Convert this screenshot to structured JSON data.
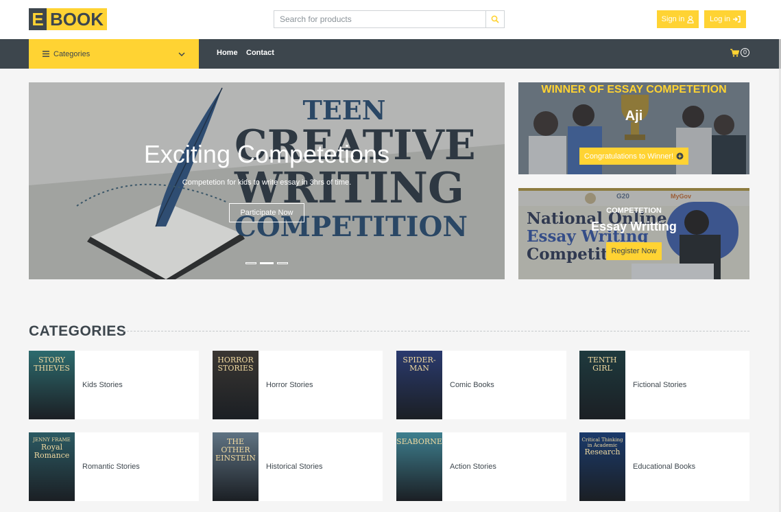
{
  "brand": {
    "e": "E",
    "book": "BOOK"
  },
  "search": {
    "placeholder": "Search for products"
  },
  "auth": {
    "sign_in": "Sign in",
    "log_in": "Log in"
  },
  "nav": {
    "categories": "Categories",
    "links": [
      "Home",
      "Contact"
    ],
    "cart_count": "0"
  },
  "hero": {
    "title": "Exciting Competetions",
    "subtitle": "Competetion for kids to write essay in 3hrs of time.",
    "button": "Participate Now",
    "image_text": [
      "TEEN",
      "CREATIVE",
      "WRITING",
      "COMPETITION"
    ],
    "active_slide": 2,
    "slides": 3
  },
  "promo1": {
    "heading": "WINNER OF ESSAY COMPETETION",
    "name": "Aji",
    "button": "Congratulations to Winner!"
  },
  "promo2": {
    "kicker": "COMPETETION",
    "title": "Essay Writting",
    "button": "Register Now",
    "bg_text": [
      "National Online",
      "Essay Writing",
      "Competition"
    ],
    "logos": [
      "G20",
      "MyGov"
    ]
  },
  "categories": {
    "heading": "CATEGORIES",
    "items": [
      {
        "label": "Kids Stories",
        "cover_text": [
          "STORY",
          "THIEVES"
        ],
        "cover_color": "#2d6b6e"
      },
      {
        "label": "Horror Stories",
        "cover_text": [
          "HORROR",
          "STORIES"
        ],
        "cover_color": "#3a3632"
      },
      {
        "label": "Comic Books",
        "cover_text": [
          "SPIDER-MAN"
        ],
        "cover_color": "#2a3a6e"
      },
      {
        "label": "Fictional Stories",
        "cover_text": [
          "TENTH",
          "GIRL"
        ],
        "cover_color": "#1e3a3e"
      },
      {
        "label": "Romantic Stories",
        "cover_text": [
          "JENNY FRAME",
          "Royal",
          "Romance"
        ],
        "cover_color": "#2b5a63"
      },
      {
        "label": "Historical Stories",
        "cover_text": [
          "THE",
          "OTHER",
          "EINSTEIN"
        ],
        "cover_color": "#5f7383"
      },
      {
        "label": "Action Stories",
        "cover_text": [
          "SEABORNE"
        ],
        "cover_color": "#3e7f8f"
      },
      {
        "label": "Educational Books",
        "cover_text": [
          "Critical Thinking",
          "in Academic",
          "Research"
        ],
        "cover_color": "#1b3a6b"
      }
    ]
  },
  "colors": {
    "accent": "#FFD333",
    "dark": "#3D464D",
    "bg": "#F5F5F5"
  }
}
